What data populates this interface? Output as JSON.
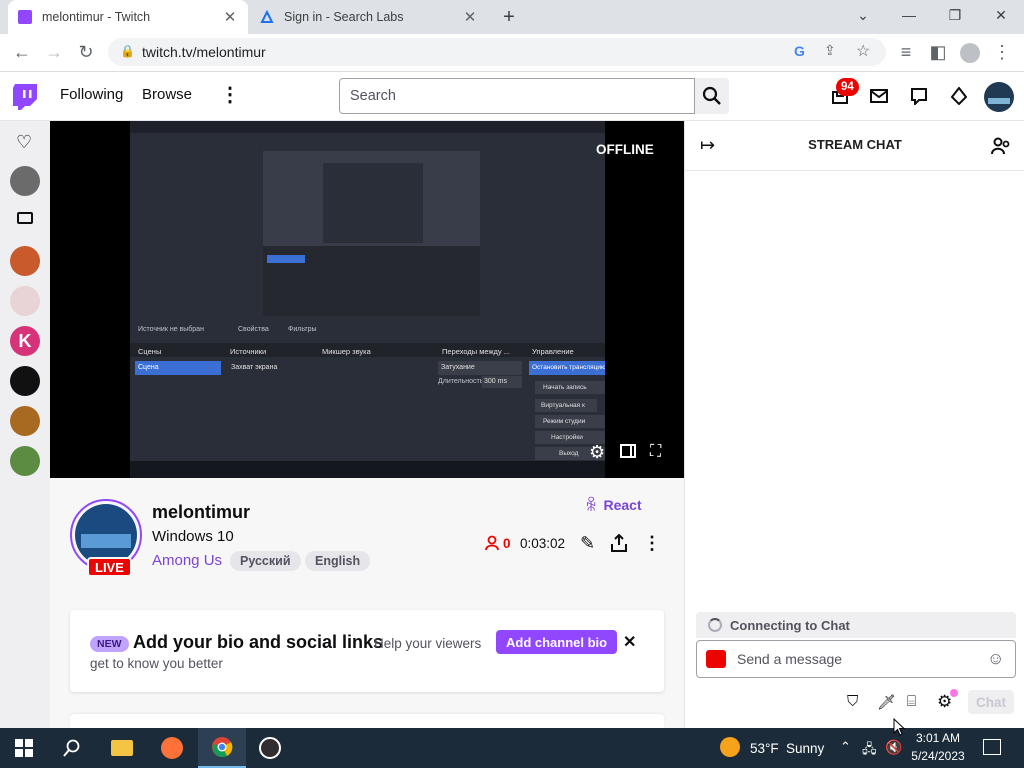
{
  "browser": {
    "tabs": [
      {
        "title": "melontimur - Twitch",
        "active": true
      },
      {
        "title": "Sign in - Search Labs",
        "active": false
      }
    ],
    "new_tab": "+",
    "url": "twitch.tv/melontimur"
  },
  "nav": {
    "following": "Following",
    "browse": "Browse",
    "search_placeholder": "Search",
    "notifications_count": "94"
  },
  "player": {
    "status": "OFFLINE",
    "obs_panels": [
      "Сцены",
      "Источники",
      "Микшер звука",
      "Переходы между ...",
      "Управление"
    ],
    "obs_no_source": "Источник не выбран",
    "obs_properties": "Свойства",
    "obs_filters": "Фильтры",
    "obs_controls": [
      "Остановить трансляцию",
      "Начать запись",
      "Виртуальная к",
      "Режим студии",
      "Настройки",
      "Выход"
    ],
    "obs_transition": "Затухание",
    "obs_duration_label": "Длительность",
    "obs_duration_value": "300 ms",
    "obs_scene": "Сцена",
    "obs_source": "Захват экрана"
  },
  "channel": {
    "name": "melontimur",
    "title": "Windows 10",
    "category": "Among Us",
    "tags": [
      "Русский",
      "English"
    ],
    "live_badge": "LIVE",
    "react": "React",
    "viewers": "0",
    "uptime": "0:03:02"
  },
  "bio": {
    "new_badge": "NEW",
    "heading": "Add your bio and social links",
    "text_inline": "Help your viewers",
    "text_line2": "get to know you better",
    "button": "Add channel bio"
  },
  "chat": {
    "header": "STREAM CHAT",
    "connecting": "Connecting to Chat",
    "placeholder": "Send a message",
    "send_button": "Chat"
  },
  "taskbar": {
    "weather_temp": "53°F",
    "weather_text": "Sunny",
    "time": "3:01 AM",
    "date": "5/24/2023"
  },
  "colors": {
    "twitch_purple": "#9147ff",
    "live_red": "#eb0400",
    "taskbar": "#1c2b3a"
  }
}
